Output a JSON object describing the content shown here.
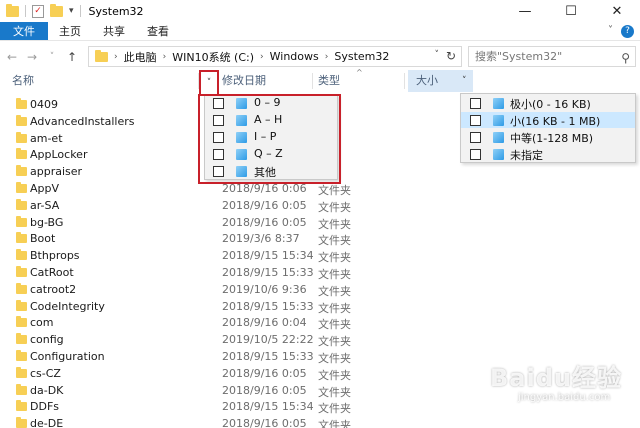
{
  "window": {
    "title": "System32",
    "controls": {
      "minimize": "—",
      "maximize": "☐",
      "close": "✕"
    }
  },
  "ribbon": {
    "tabs": [
      "文件",
      "主页",
      "共享",
      "查看"
    ],
    "collapse_glyph": "˅",
    "help_glyph": "?"
  },
  "nav": {
    "back": "←",
    "forward": "→",
    "recent": "˅",
    "up": "↑",
    "breadcrumb": [
      "此电脑",
      "WIN10系统 (C:)",
      "Windows",
      "System32"
    ],
    "refresh": "↻",
    "search_placeholder": "搜索\"System32\"",
    "search_icon": "⚲"
  },
  "columns": {
    "name": "名称",
    "date": "修改日期",
    "type": "类型",
    "size": "大小",
    "filter_glyph": "˅"
  },
  "name_filter": {
    "options": [
      "0 – 9",
      "A – H",
      "I – P",
      "Q – Z",
      "其他"
    ]
  },
  "size_filter": {
    "options": [
      "极小(0 - 16 KB)",
      "小(16 KB - 1 MB)",
      "中等(1-128 MB)",
      "未指定"
    ],
    "highlighted_index": 1
  },
  "files": [
    {
      "name": "0409",
      "date": "",
      "type": ""
    },
    {
      "name": "AdvancedInstallers",
      "date": "",
      "type": ""
    },
    {
      "name": "am-et",
      "date": "",
      "type": ""
    },
    {
      "name": "AppLocker",
      "date": "",
      "type": ""
    },
    {
      "name": "appraiser",
      "date": "",
      "type": ""
    },
    {
      "name": "AppV",
      "date": "2018/9/16 0:06",
      "type": "文件夹"
    },
    {
      "name": "ar-SA",
      "date": "2018/9/16 0:05",
      "type": "文件夹"
    },
    {
      "name": "bg-BG",
      "date": "2018/9/16 0:05",
      "type": "文件夹"
    },
    {
      "name": "Boot",
      "date": "2019/3/6 8:37",
      "type": "文件夹"
    },
    {
      "name": "Bthprops",
      "date": "2018/9/15 15:34",
      "type": "文件夹"
    },
    {
      "name": "CatRoot",
      "date": "2018/9/15 15:33",
      "type": "文件夹"
    },
    {
      "name": "catroot2",
      "date": "2019/10/6 9:36",
      "type": "文件夹"
    },
    {
      "name": "CodeIntegrity",
      "date": "2018/9/15 15:33",
      "type": "文件夹"
    },
    {
      "name": "com",
      "date": "2018/9/16 0:04",
      "type": "文件夹"
    },
    {
      "name": "config",
      "date": "2019/10/5 22:22",
      "type": "文件夹"
    },
    {
      "name": "Configuration",
      "date": "2018/9/15 15:33",
      "type": "文件夹"
    },
    {
      "name": "cs-CZ",
      "date": "2018/9/16 0:05",
      "type": "文件夹"
    },
    {
      "name": "da-DK",
      "date": "2018/9/16 0:05",
      "type": "文件夹"
    },
    {
      "name": "DDFs",
      "date": "2018/9/15 15:34",
      "type": "文件夹"
    },
    {
      "name": "de-DE",
      "date": "2018/9/16 0:05",
      "type": "文件夹"
    }
  ],
  "watermark": {
    "logo": "Baidu经验",
    "url": "jingyan.baidu.com"
  },
  "colors": {
    "accent": "#1979ca",
    "highlight_box": "#c8202a",
    "folder": "#f7cf55",
    "selected": "#cce8ff"
  }
}
